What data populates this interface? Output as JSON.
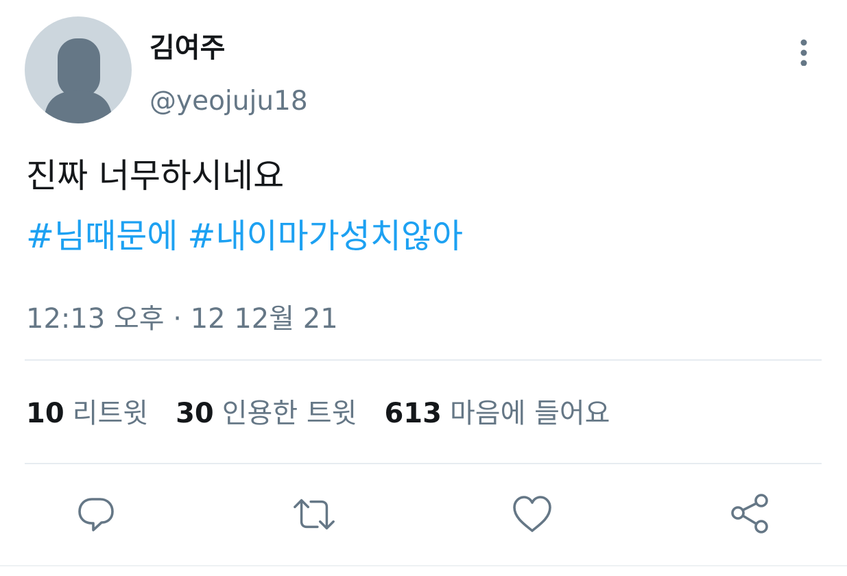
{
  "user": {
    "display_name": "김여주",
    "handle": "@yeojuju18",
    "avatar_icon": "default-avatar-icon"
  },
  "tweet": {
    "text": "진짜 너무하시네요",
    "hashtags": [
      "#님때문에",
      "#내이마가성치않아"
    ],
    "timestamp": "12:13 오후 · 12 12월 21"
  },
  "stats": [
    {
      "count": "10",
      "label": "리트윗"
    },
    {
      "count": "30",
      "label": "인용한 트윗"
    },
    {
      "count": "613",
      "label": "마음에 들어요"
    }
  ],
  "actions": {
    "reply_icon": "reply-icon",
    "retweet_icon": "retweet-icon",
    "like_icon": "heart-icon",
    "share_icon": "share-icon"
  },
  "colors": {
    "hashtag": "#1da1f2",
    "secondary_text": "#657786",
    "primary_text": "#14171a",
    "avatar_bg": "#ccd6dd",
    "avatar_figure": "#657786",
    "divider": "#e6ecf0"
  }
}
